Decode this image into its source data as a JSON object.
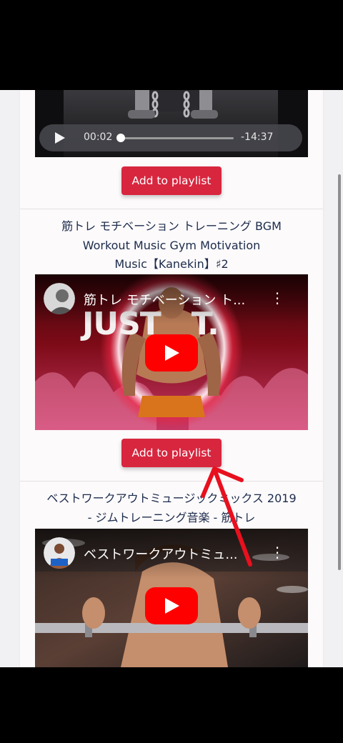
{
  "audio": {
    "elapsed": "00:02",
    "remaining": "-14:37",
    "progress_fraction": 0.01
  },
  "button_label": "Add to playlist",
  "videos": [
    {
      "title_lines": [
        "筋トレ モチベーション トレーニング BGM",
        "Workout Music Gym Motivation",
        "Music【Kanekin】♯2"
      ],
      "overlay_title": "筋トレ モチベーション ト...",
      "thumbnail_text": "JUST   T."
    },
    {
      "title_lines": [
        "ベストワークアウトミュージックミックス 2019",
        "- ジムトレーニング音楽 - 筋トレ"
      ],
      "overlay_title": "ベストワークアウトミュ..."
    }
  ],
  "colors": {
    "accent": "#d8263f",
    "annotation_arrow": "#e8101e",
    "youtube_red": "#ff0000",
    "title_text": "#1c2b4b"
  },
  "icons": [
    "play-icon",
    "youtube-play-icon",
    "more-vert-icon",
    "channel-avatar",
    "annotation-arrow"
  ]
}
